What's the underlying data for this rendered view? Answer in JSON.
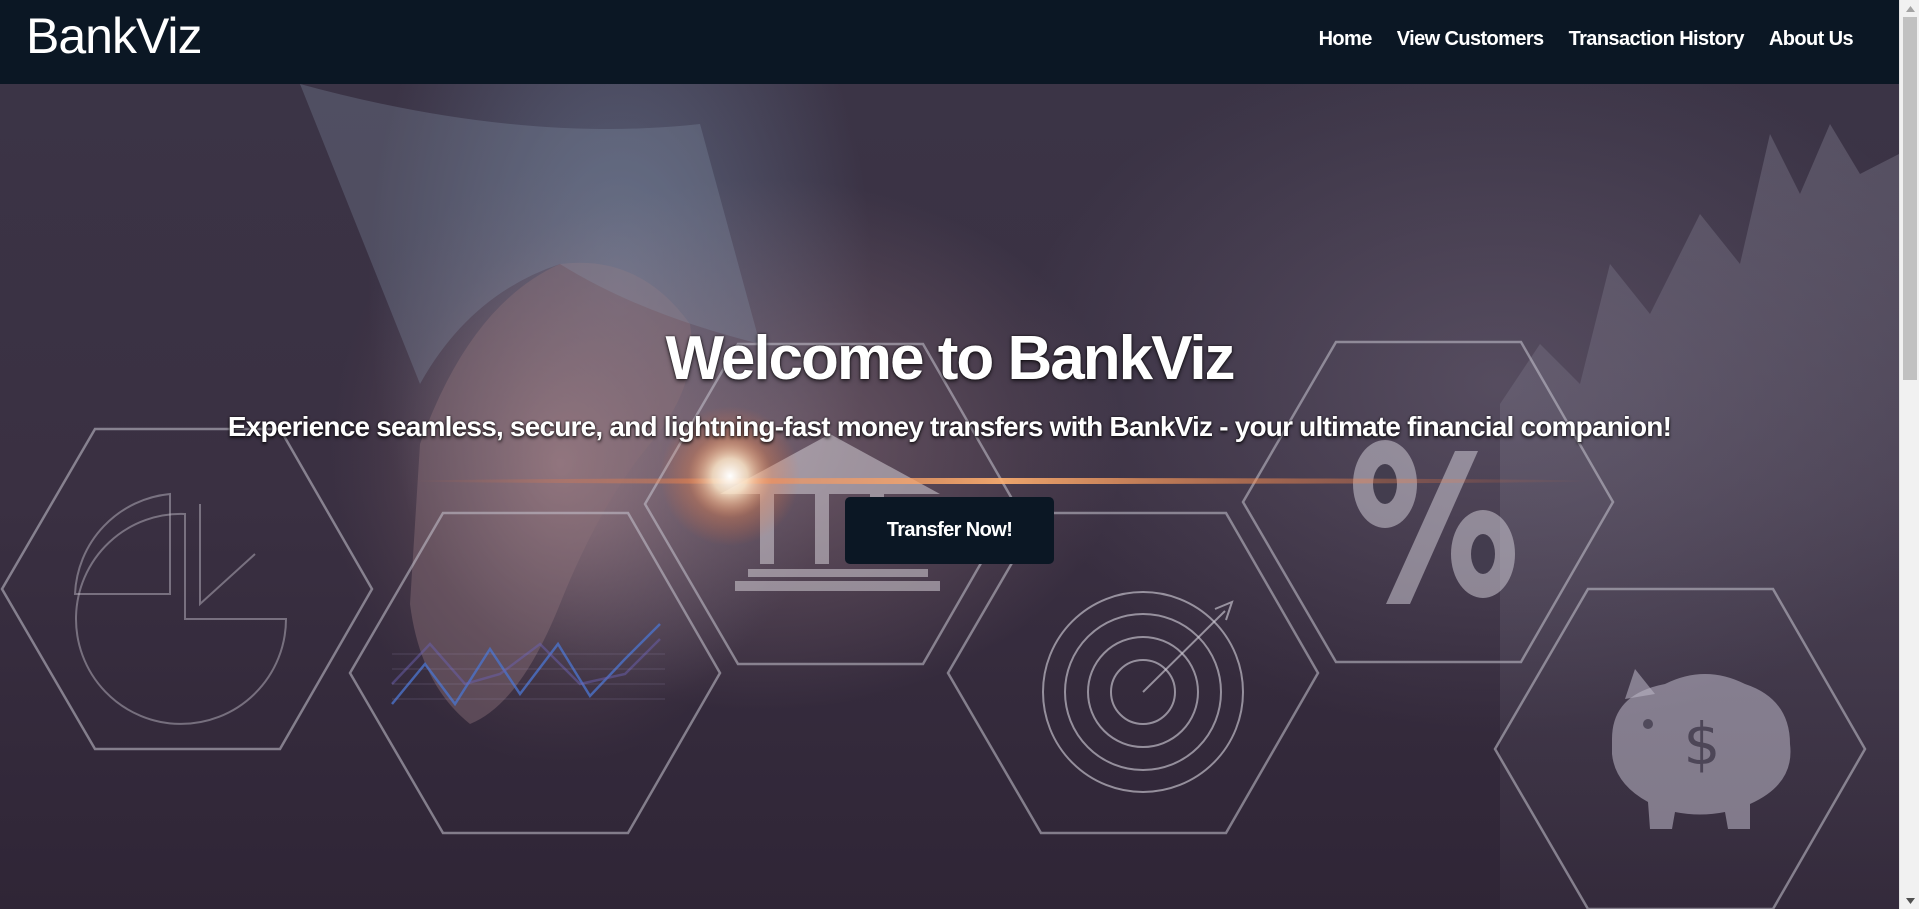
{
  "brand": {
    "name": "BankViz"
  },
  "nav": {
    "items": [
      {
        "label": "Home"
      },
      {
        "label": "View Customers"
      },
      {
        "label": "Transaction History"
      },
      {
        "label": "About Us"
      }
    ]
  },
  "hero": {
    "title": "Welcome to BankViz",
    "subtitle": "Experience seamless, secure, and lightning-fast money transfers with BankViz - your ultimate financial companion!",
    "cta_label": "Transfer Now!"
  },
  "colors": {
    "navbar_bg": "#0b1724",
    "button_bg": "#0b1724",
    "text": "#ffffff"
  },
  "icons": [
    "pie-chart-icon",
    "line-chart-icon",
    "bank-icon",
    "target-icon",
    "percent-icon",
    "piggy-bank-icon"
  ]
}
